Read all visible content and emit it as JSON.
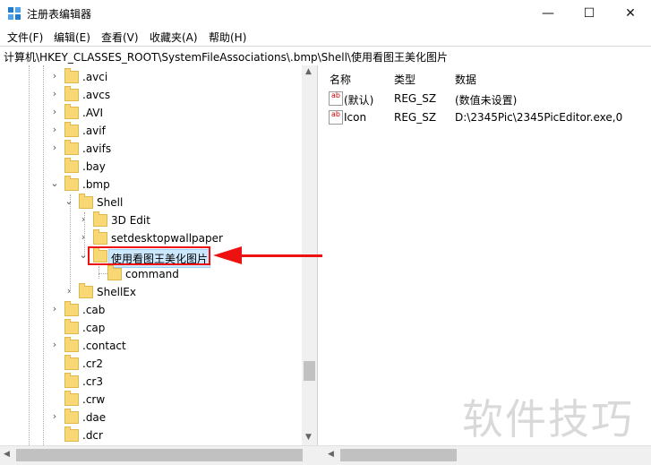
{
  "window": {
    "title": "注册表编辑器",
    "min_label": "—",
    "max_label": "☐",
    "close_label": "✕"
  },
  "menu": [
    "文件(F)",
    "编辑(E)",
    "查看(V)",
    "收藏夹(A)",
    "帮助(H)"
  ],
  "address": "计算机\\HKEY_CLASSES_ROOT\\SystemFileAssociations\\.bmp\\Shell\\使用看图王美化图片",
  "tree": [
    {
      "label": ".avci",
      "chevron": "›"
    },
    {
      "label": ".avcs",
      "chevron": "›"
    },
    {
      "label": ".AVI",
      "chevron": "›"
    },
    {
      "label": ".avif",
      "chevron": "›"
    },
    {
      "label": ".avifs",
      "chevron": "›"
    },
    {
      "label": ".bay",
      "chevron": ""
    },
    {
      "label": ".bmp",
      "chevron": "⌄"
    },
    {
      "label": "Shell",
      "chevron": "⌄"
    },
    {
      "label": "3D Edit",
      "chevron": "›"
    },
    {
      "label": "setdesktopwallpaper",
      "chevron": "›"
    },
    {
      "label": "使用看图王美化图片",
      "chevron": "⌄"
    },
    {
      "label": "command",
      "chevron": ""
    },
    {
      "label": "ShellEx",
      "chevron": "›"
    },
    {
      "label": ".cab",
      "chevron": "›"
    },
    {
      "label": ".cap",
      "chevron": ""
    },
    {
      "label": ".contact",
      "chevron": "›"
    },
    {
      "label": ".cr2",
      "chevron": ""
    },
    {
      "label": ".cr3",
      "chevron": ""
    },
    {
      "label": ".crw",
      "chevron": ""
    },
    {
      "label": ".dae",
      "chevron": "›"
    },
    {
      "label": ".dcr",
      "chevron": ""
    }
  ],
  "columns": {
    "name": "名称",
    "type": "类型",
    "data": "数据"
  },
  "values": [
    {
      "name": "(默认)",
      "type": "REG_SZ",
      "data": "(数值未设置)"
    },
    {
      "name": "Icon",
      "type": "REG_SZ",
      "data": "D:\\2345Pic\\2345PicEditor.exe,0"
    }
  ],
  "watermark": "软件技巧",
  "colors": {
    "highlight": "#cce8ff",
    "annotation": "#ee1111",
    "folder": "#f8d775"
  }
}
